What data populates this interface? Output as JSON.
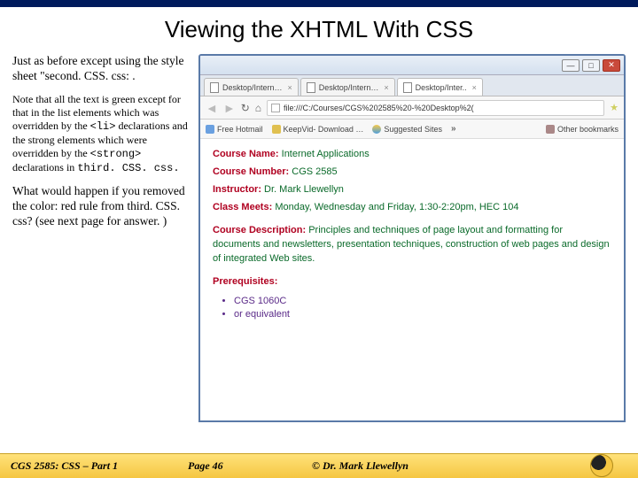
{
  "title": "Viewing the XHTML With CSS",
  "left": {
    "p1": "Just as before except using the style sheet \"second. CSS. css: .",
    "note_a": "Note that all the text is green except for that in the list elements which was overridden by the ",
    "note_code1": "<li>",
    "note_b": " declarations and the strong elements which were overridden by the ",
    "note_code2": "<strong>",
    "note_c": "  declarations in ",
    "note_code3": "third. CSS. css.",
    "p2": "What would happen if you removed the color: red rule from third. CSS. css? (see next page for answer. )"
  },
  "browser": {
    "tabs": [
      "Desktop/Intern…",
      "Desktop/Intern…",
      "Desktop/Inter.. "
    ],
    "url": "file:///C:/Courses/CGS%202585%20-%20Desktop%2(",
    "bookmarks": {
      "a": "Free Hotmail",
      "b": "KeepVid- Download …",
      "c": "Suggested Sites",
      "more": "»",
      "other": "Other bookmarks"
    }
  },
  "page": {
    "r1l": "Course Name:",
    "r1v": " Internet Applications",
    "r2l": "Course Number:",
    "r2v": " CGS 2585",
    "r3l": "Instructor:",
    "r3v": " Dr. Mark Llewellyn",
    "r4l": "Class Meets:",
    "r4v": " Monday, Wednesday and Friday, 1:30-2:20pm, HEC 104",
    "r5l": "Course Description:",
    "r5v": " Principles and techniques of page layout and formatting for documents and newsletters, presentation techniques, construction of web pages and design of integrated Web sites.",
    "r6l": "Prerequisites:",
    "li1": "CGS 1060C",
    "li2": "or equivalent"
  },
  "footer": {
    "left": "CGS 2585: CSS – Part 1",
    "mid": "Page 46",
    "right": "© Dr. Mark Llewellyn"
  }
}
